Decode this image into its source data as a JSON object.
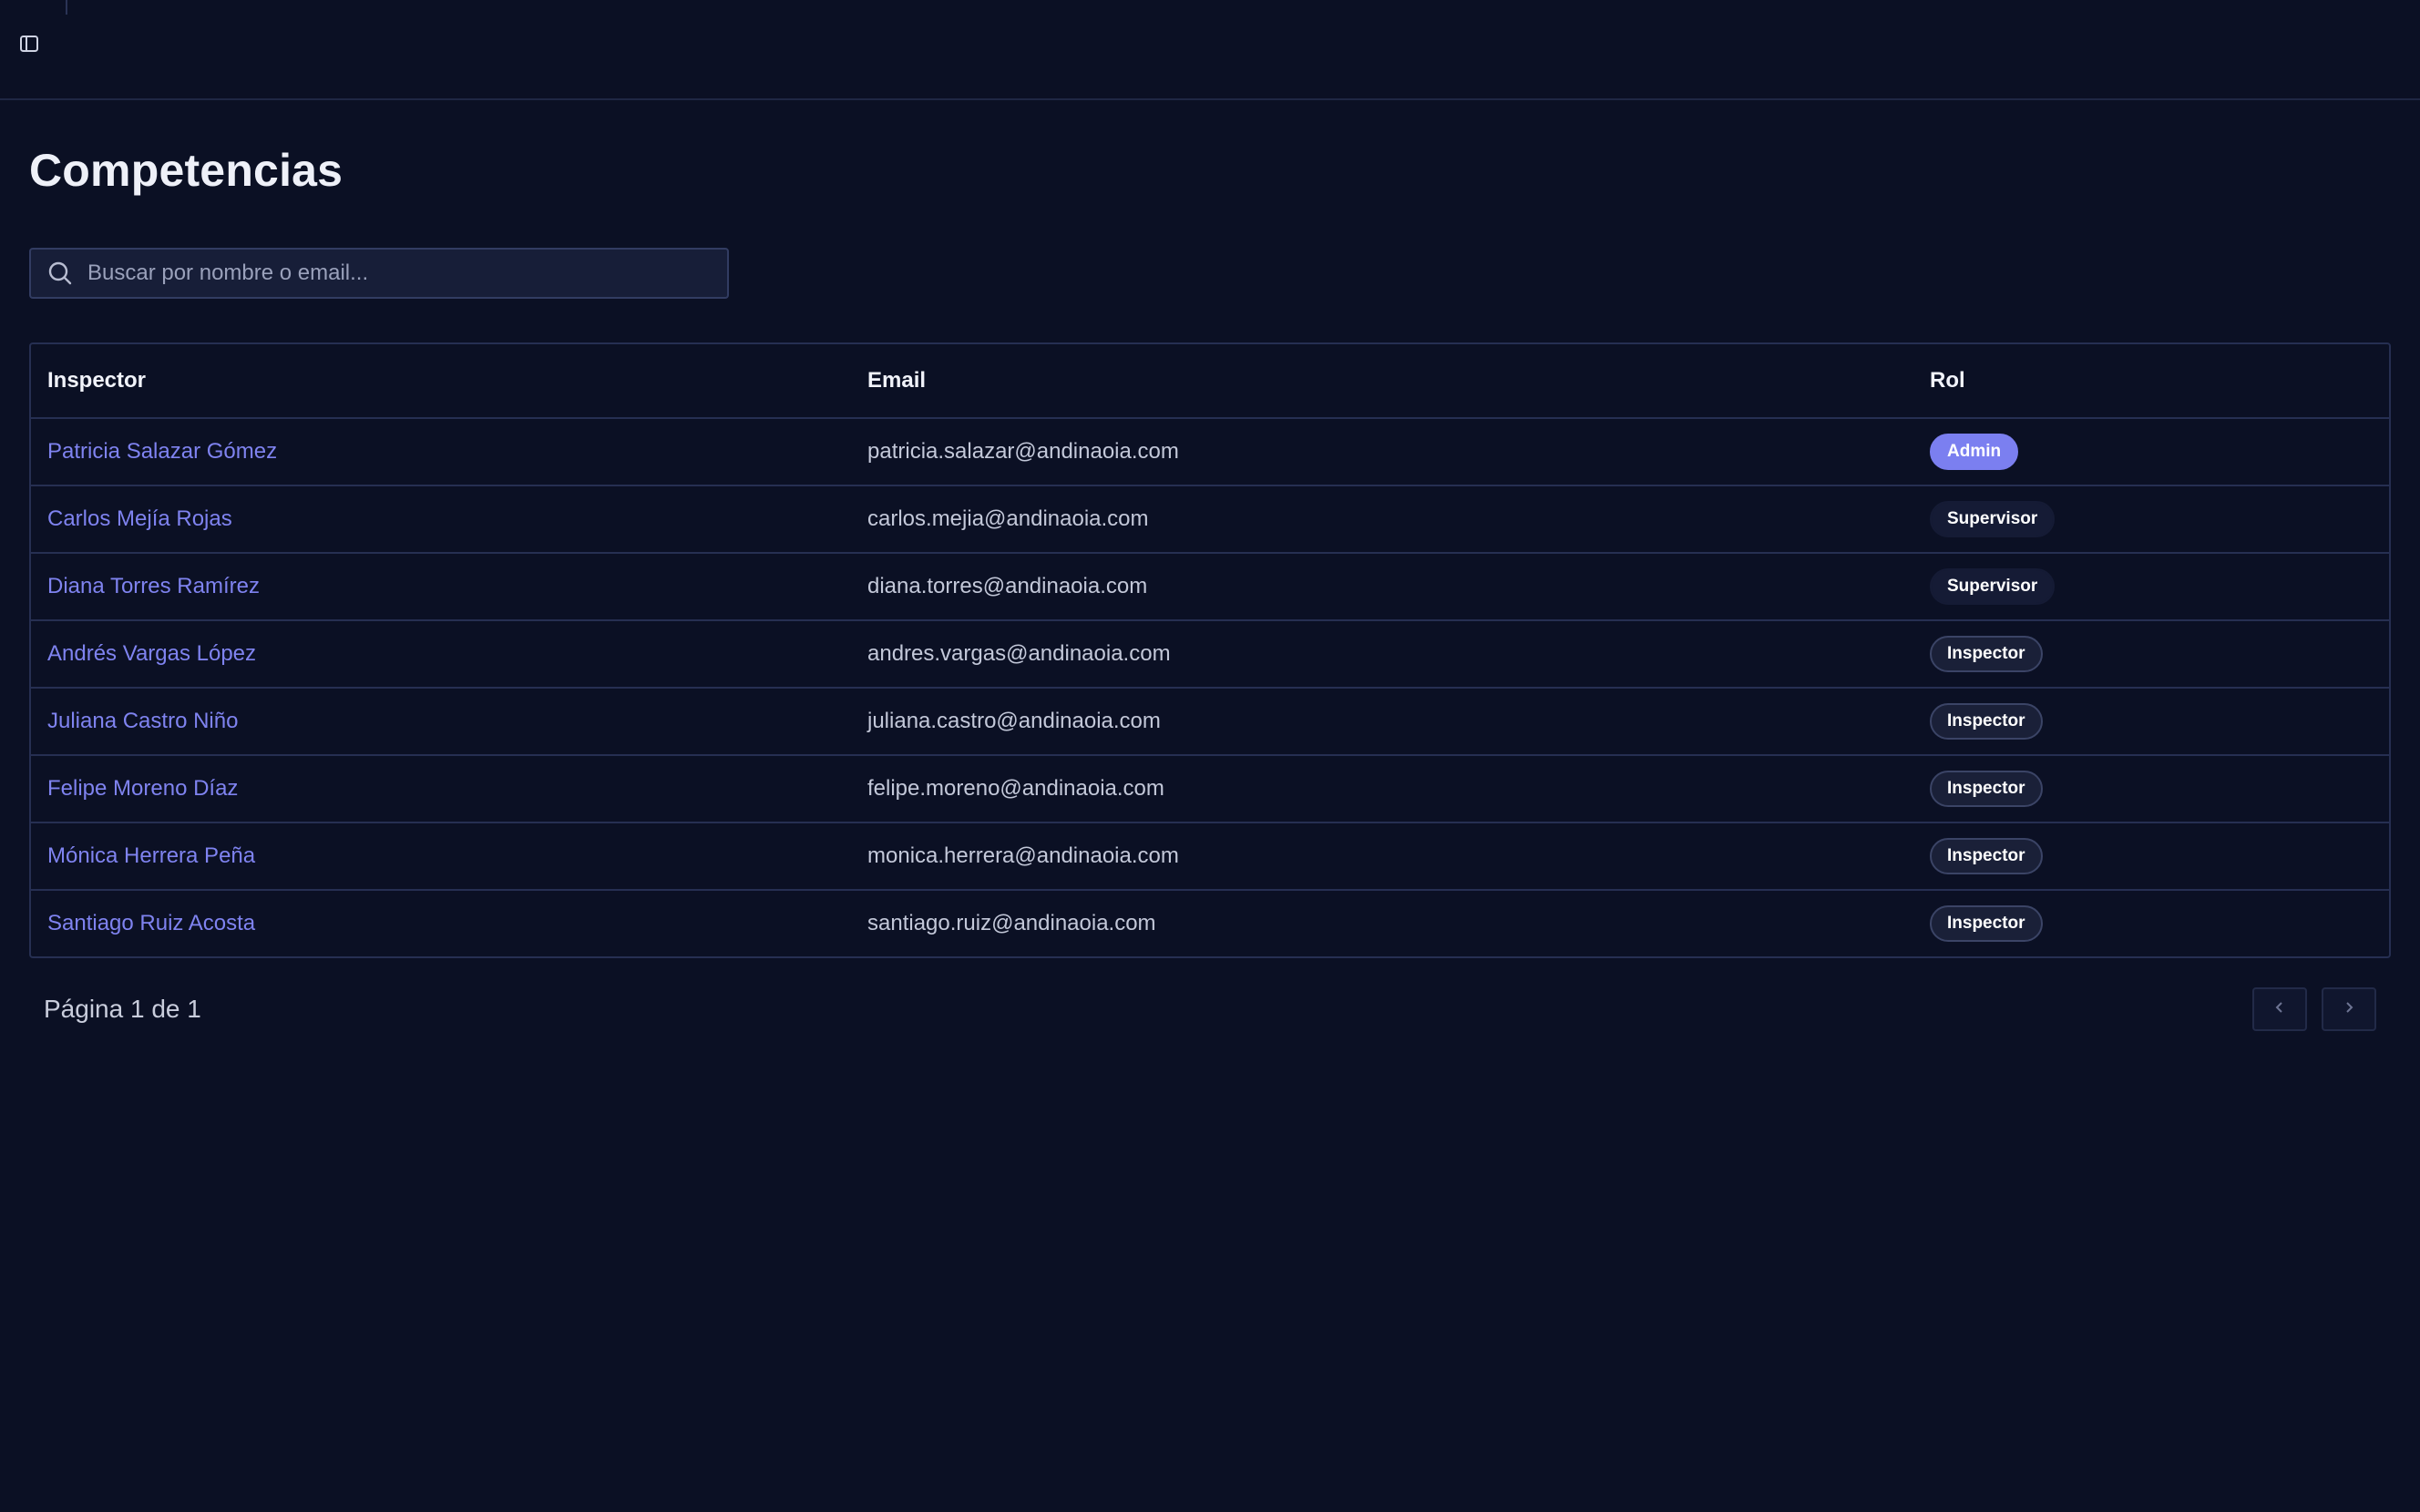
{
  "header": {
    "sidebar_toggle_icon": "sidebar-toggle-icon"
  },
  "page": {
    "title": "Competencias"
  },
  "search": {
    "placeholder": "Buscar por nombre o email...",
    "value": "",
    "icon": "search-icon"
  },
  "table": {
    "columns": [
      "Inspector",
      "Email",
      "Rol"
    ],
    "rows": [
      {
        "name": "Patricia Salazar Gómez",
        "email": "patricia.salazar@andinaoia.com",
        "role": "Admin",
        "role_style": "admin"
      },
      {
        "name": "Carlos Mejía Rojas",
        "email": "carlos.mejia@andinaoia.com",
        "role": "Supervisor",
        "role_style": "supervisor"
      },
      {
        "name": "Diana Torres Ramírez",
        "email": "diana.torres@andinaoia.com",
        "role": "Supervisor",
        "role_style": "supervisor"
      },
      {
        "name": "Andrés Vargas López",
        "email": "andres.vargas@andinaoia.com",
        "role": "Inspector",
        "role_style": "inspector"
      },
      {
        "name": "Juliana Castro Niño",
        "email": "juliana.castro@andinaoia.com",
        "role": "Inspector",
        "role_style": "inspector"
      },
      {
        "name": "Felipe Moreno Díaz",
        "email": "felipe.moreno@andinaoia.com",
        "role": "Inspector",
        "role_style": "inspector"
      },
      {
        "name": "Mónica Herrera Peña",
        "email": "monica.herrera@andinaoia.com",
        "role": "Inspector",
        "role_style": "inspector"
      },
      {
        "name": "Santiago Ruiz Acosta",
        "email": "santiago.ruiz@andinaoia.com",
        "role": "Inspector",
        "role_style": "inspector"
      }
    ]
  },
  "pagination": {
    "label": "Página 1 de 1",
    "prev_icon": "chevron-left-icon",
    "next_icon": "chevron-right-icon"
  },
  "colors": {
    "background": "#0b1024",
    "accent": "#7b7ff0",
    "border": "#262f52",
    "link": "#7f83f0"
  }
}
